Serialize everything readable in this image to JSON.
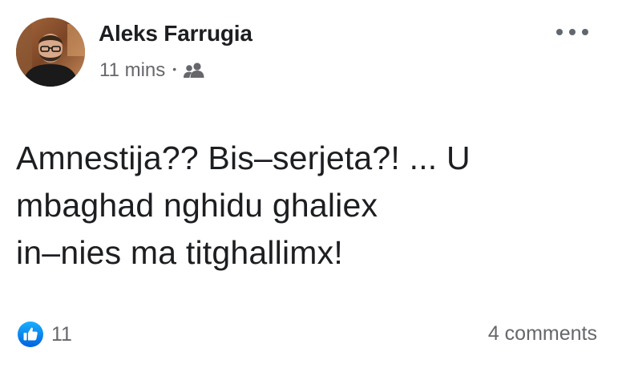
{
  "post": {
    "author": "Aleks Farrugia",
    "timestamp": "11 mins",
    "separator": "•",
    "audience_icon": "friends-icon",
    "more_icon": "more-options-icon",
    "body_lines": [
      "Amnestija?? Bis–serjeta?! ... U",
      "mbaghad nghidu ghaliex",
      "in–nies ma titghallimx!"
    ],
    "reactions": {
      "icon": "like-icon",
      "count": "11"
    },
    "comments_label": "4 comments"
  },
  "colors": {
    "text": "#1c1e21",
    "secondary": "#65676b",
    "like_blue": "#1877f2"
  }
}
